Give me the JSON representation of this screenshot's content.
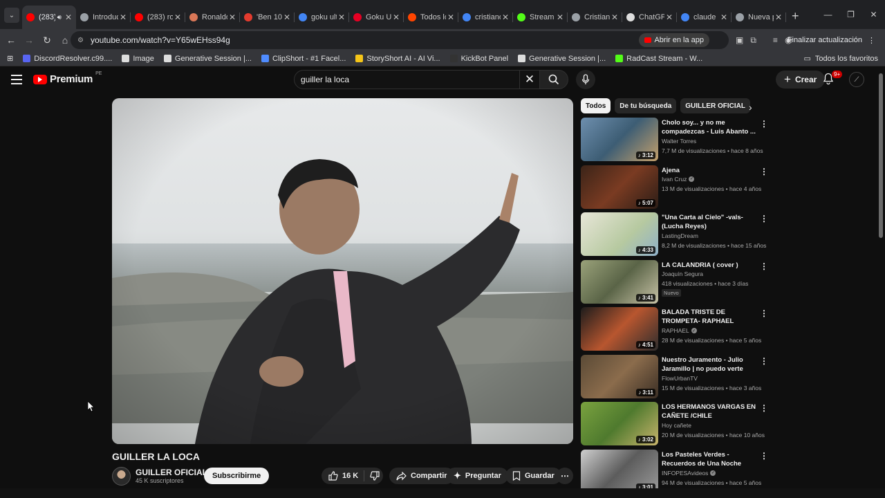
{
  "browser": {
    "tabs": [
      {
        "label": "(283)",
        "color": "#ff0000",
        "active": true
      },
      {
        "label": "Introduc",
        "color": "#9aa0a6"
      },
      {
        "label": "(283) ro",
        "color": "#ff0000"
      },
      {
        "label": "Ronaldo",
        "color": "#d97757"
      },
      {
        "label": "'Ben 10'",
        "color": "#e33b2e"
      },
      {
        "label": "goku ulti",
        "color": "#4285f4"
      },
      {
        "label": "Goku Ult",
        "color": "#e60023"
      },
      {
        "label": "Todos lo",
        "color": "#ff4500"
      },
      {
        "label": "cristiano",
        "color": "#4285f4"
      },
      {
        "label": "Stream",
        "color": "#53fc18"
      },
      {
        "label": "Cristiano",
        "color": "#9aa0a6"
      },
      {
        "label": "ChatGPT",
        "color": "#dddddd"
      },
      {
        "label": "claude",
        "color": "#4285f4"
      },
      {
        "label": "Nueva p",
        "color": "#9aa0a6"
      }
    ],
    "url": "youtube.com/watch?v=Y65wEHss94g",
    "open_in_app": "Abrir en la app",
    "update_label": "Finalizar actualización",
    "bookmarks": [
      {
        "label": "DiscordResolver.c99....",
        "color": "#5865f2"
      },
      {
        "label": "Image",
        "color": "#dddddd"
      },
      {
        "label": "Generative Session |...",
        "color": "#dddddd"
      },
      {
        "label": "ClipShort - #1 Facel...",
        "color": "#4f8cff"
      },
      {
        "label": "StoryShort AI - AI Vi...",
        "color": "#f5c518"
      },
      {
        "label": "KickBot Panel",
        "color": "#333333"
      },
      {
        "label": "Generative Session |...",
        "color": "#dddddd"
      },
      {
        "label": "RadCast Stream - W...",
        "color": "#53fc18"
      }
    ],
    "all_bookmarks": "Todos los favoritos"
  },
  "youtube": {
    "brand": "Premium",
    "country": "PE",
    "search_query": "guiller la loca",
    "create_label": "Crear",
    "notifications_badge": "9+",
    "video": {
      "title": "GUILLER LA LOCA",
      "channel": "GUILLER OFICIAL",
      "subscribers": "45 K suscriptores",
      "subscribe_label": "Subscribirme",
      "likes": "16 K",
      "share_label": "Compartir",
      "ask_label": "Preguntar",
      "save_label": "Guardar"
    },
    "chips": [
      "Todos",
      "De tu búsqueda",
      "GUILLER OFICIAL"
    ],
    "recommendations": [
      {
        "title": "Cholo soy... y no me compadezcas - Luis Abanto ...",
        "channel": "Walter Torres",
        "verified": false,
        "meta": "7,7 M de visualizaciones • hace 8 años",
        "duration": "3:12",
        "is_new": false
      },
      {
        "title": "Ajena",
        "channel": "Ivan Cruz",
        "verified": true,
        "meta": "13 M de visualizaciones • hace 4 años",
        "duration": "5:07",
        "is_new": false
      },
      {
        "title": "\"Una Carta al Cielo\" -vals- (Lucha Reyes)",
        "channel": "LastingDream",
        "verified": false,
        "meta": "8,2 M de visualizaciones • hace 15 años",
        "duration": "4:33",
        "is_new": false
      },
      {
        "title": "LA CALANDRIA ( cover )",
        "channel": "Joaquín Segura",
        "verified": false,
        "meta": "418 visualizaciones • hace 3 días",
        "duration": "3:41",
        "is_new": true,
        "new_label": "Nuevo"
      },
      {
        "title": "BALADA TRISTE DE TROMPETA- RAPHAEL",
        "channel": "RAPHAEL",
        "verified": true,
        "meta": "28 M de visualizaciones • hace 5 años",
        "duration": "4:51",
        "is_new": false
      },
      {
        "title": "Nuestro Juramento - Julio Jaramillo | no puedo verte trist...",
        "channel": "FlowUrbanTV",
        "verified": false,
        "meta": "15 M de visualizaciones • hace 3 años",
        "duration": "3:11",
        "is_new": false
      },
      {
        "title": "LOS HERMANOS VARGAS EN CAÑETE /CHILE",
        "channel": "Hoy cañete",
        "verified": false,
        "meta": "20 M de visualizaciones • hace 10 años",
        "duration": "3:02",
        "is_new": false
      },
      {
        "title": "Los Pasteles Verdes - Recuerdos de Una Noche (Vid...",
        "channel": "INFOPESAvideos",
        "verified": true,
        "meta": "94 M de visualizaciones • hace 5 años",
        "duration": "3:01",
        "is_new": false
      }
    ]
  },
  "colors": {
    "accent": "#ff0000",
    "background": "#0f0f0f",
    "surface": "#272727"
  }
}
